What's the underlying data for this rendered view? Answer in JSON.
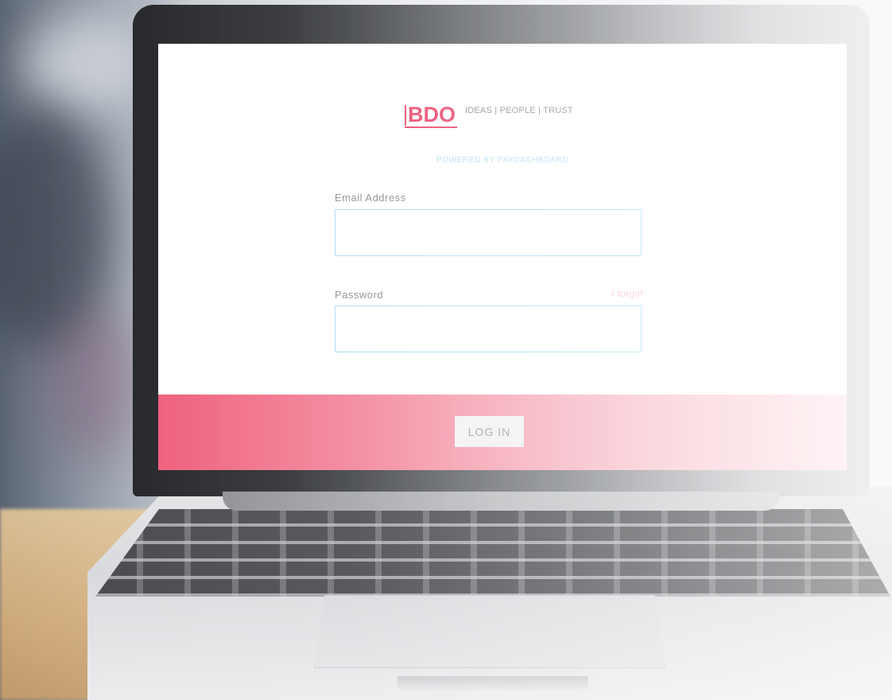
{
  "brand": {
    "logo_text": "BDO",
    "tagline": "IDEAS | PEOPLE | TRUST",
    "powered_by": "POWERED BY PAYDASHBOARD"
  },
  "form": {
    "email_label": "Email Address",
    "email_value": "",
    "password_label": "Password",
    "password_value": "",
    "forgot_label": "I forgot",
    "login_label": "LOG IN"
  },
  "colors": {
    "brand_accent": "#e8456a",
    "input_border": "#a9dcef",
    "powered_text": "#b6dcef"
  }
}
